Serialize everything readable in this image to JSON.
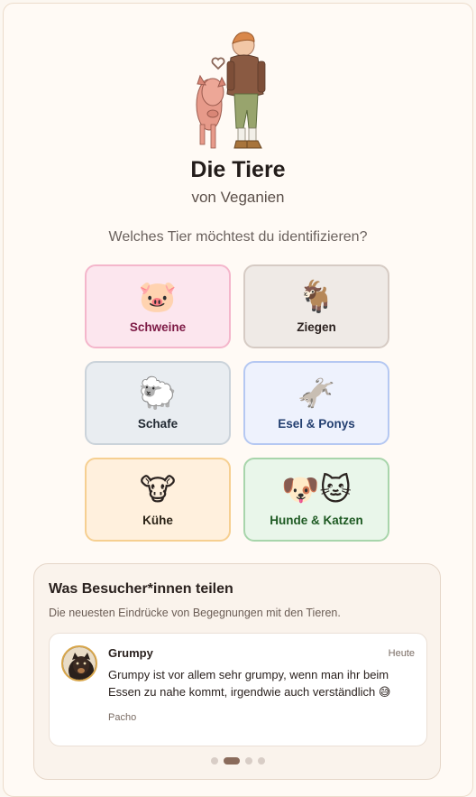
{
  "header": {
    "title": "Die Tiere",
    "subtitle": "von Veganien",
    "question": "Welches Tier möchtest du identifizieren?"
  },
  "categories": [
    {
      "label": "Schweine",
      "icon": "pig-face-icon",
      "emoji": "🐷"
    },
    {
      "label": "Ziegen",
      "icon": "goat-icon",
      "emoji": "🐐"
    },
    {
      "label": "Schafe",
      "icon": "sheep-icon",
      "emoji": "🐑"
    },
    {
      "label": "Esel & Ponys",
      "icon": "donkey-icon",
      "emoji": "🫏"
    },
    {
      "label": "Kühe",
      "icon": "cow-face-icon",
      "emoji": "🐮"
    },
    {
      "label": "Hunde & Katzen",
      "icon": "dog-cat-icon",
      "emoji": "🐶🐱"
    }
  ],
  "testimonials": {
    "title": "Was Besucher*innen teilen",
    "subtitle": "Die neuesten Eindrücke von Begegnungen mit den Tieren.",
    "current": {
      "name": "Grumpy",
      "date": "Heute",
      "text": "Grumpy ist vor allem sehr grumpy, wenn man ihr beim Essen zu nahe kommt, irgendwie auch verständlich 😅",
      "author": "Pacho"
    },
    "page_count": 4,
    "active_page": 2
  },
  "colors": {
    "background": "#fffaf5",
    "schweine": "#fce6ee",
    "ziegen": "#efeae6",
    "schafe": "#e9edf1",
    "esel": "#eef2fd",
    "kuehe": "#fff0dd",
    "hunde": "#e9f6ea",
    "accent": "#8a6b5b"
  }
}
